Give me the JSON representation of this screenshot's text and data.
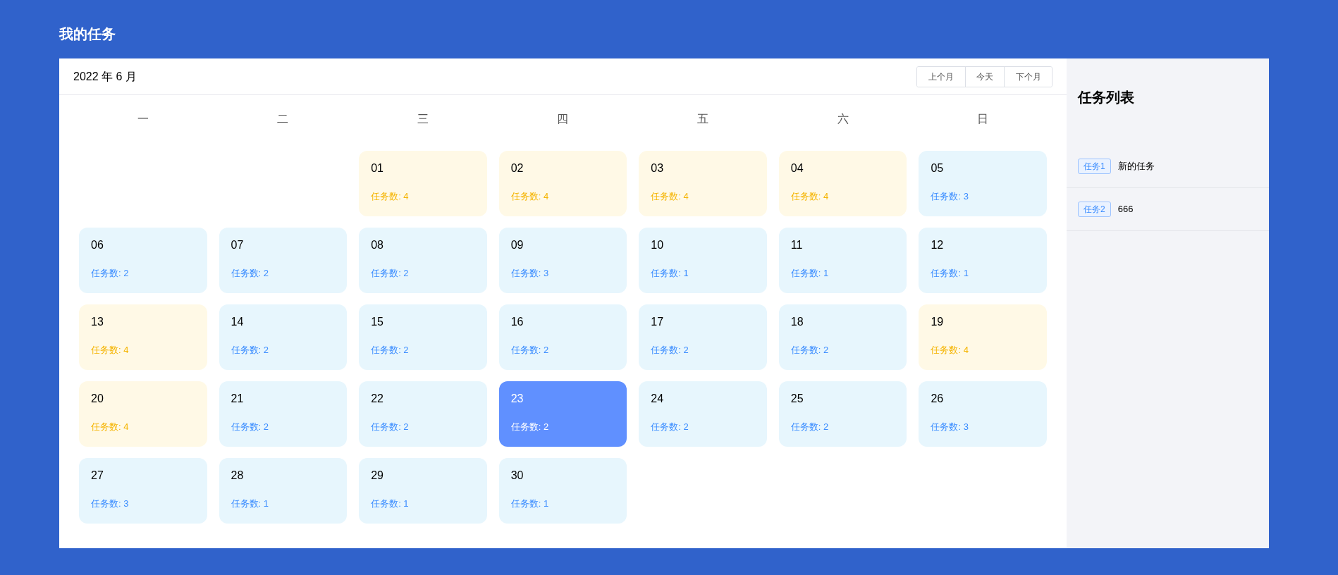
{
  "page_title": "我的任务",
  "calendar": {
    "month_label": "2022 年 6 月",
    "nav_buttons": [
      "上个月",
      "今天",
      "下个月"
    ],
    "weekdays": [
      "一",
      "二",
      "三",
      "四",
      "五",
      "六",
      "日"
    ],
    "weeks": [
      {
        "days": [
          {
            "kind": "blank"
          },
          {
            "kind": "blank"
          },
          {
            "kind": "busy",
            "date": "01",
            "count": "任务数: 4",
            "selected": false
          },
          {
            "kind": "busy",
            "date": "02",
            "count": "任务数: 4",
            "selected": false
          },
          {
            "kind": "busy",
            "date": "03",
            "count": "任务数: 4",
            "selected": false
          },
          {
            "kind": "busy",
            "date": "04",
            "count": "任务数: 4",
            "selected": false
          },
          {
            "kind": "normal",
            "date": "05",
            "count": "任务数: 3",
            "selected": false
          }
        ]
      },
      {
        "days": [
          {
            "kind": "normal",
            "date": "06",
            "count": "任务数: 2",
            "selected": false
          },
          {
            "kind": "normal",
            "date": "07",
            "count": "任务数: 2",
            "selected": false
          },
          {
            "kind": "normal",
            "date": "08",
            "count": "任务数: 2",
            "selected": false
          },
          {
            "kind": "normal",
            "date": "09",
            "count": "任务数: 3",
            "selected": false
          },
          {
            "kind": "normal",
            "date": "10",
            "count": "任务数: 1",
            "selected": false
          },
          {
            "kind": "normal",
            "date": "11",
            "count": "任务数: 1",
            "selected": false
          },
          {
            "kind": "normal",
            "date": "12",
            "count": "任务数: 1",
            "selected": false
          }
        ]
      },
      {
        "days": [
          {
            "kind": "busy",
            "date": "13",
            "count": "任务数: 4",
            "selected": false
          },
          {
            "kind": "normal",
            "date": "14",
            "count": "任务数: 2",
            "selected": false
          },
          {
            "kind": "normal",
            "date": "15",
            "count": "任务数: 2",
            "selected": false
          },
          {
            "kind": "normal",
            "date": "16",
            "count": "任务数: 2",
            "selected": false
          },
          {
            "kind": "normal",
            "date": "17",
            "count": "任务数: 2",
            "selected": false
          },
          {
            "kind": "normal",
            "date": "18",
            "count": "任务数: 2",
            "selected": false
          },
          {
            "kind": "busy",
            "date": "19",
            "count": "任务数: 4",
            "selected": false
          }
        ]
      },
      {
        "days": [
          {
            "kind": "busy",
            "date": "20",
            "count": "任务数: 4",
            "selected": false
          },
          {
            "kind": "normal",
            "date": "21",
            "count": "任务数: 2",
            "selected": false
          },
          {
            "kind": "normal",
            "date": "22",
            "count": "任务数: 2",
            "selected": false
          },
          {
            "kind": "normal",
            "date": "23",
            "count": "任务数: 2",
            "selected": true
          },
          {
            "kind": "normal",
            "date": "24",
            "count": "任务数: 2",
            "selected": false
          },
          {
            "kind": "normal",
            "date": "25",
            "count": "任务数: 2",
            "selected": false
          },
          {
            "kind": "normal",
            "date": "26",
            "count": "任务数: 3",
            "selected": false
          }
        ]
      },
      {
        "days": [
          {
            "kind": "normal",
            "date": "27",
            "count": "任务数: 3",
            "selected": false
          },
          {
            "kind": "normal",
            "date": "28",
            "count": "任务数: 1",
            "selected": false
          },
          {
            "kind": "normal",
            "date": "29",
            "count": "任务数: 1",
            "selected": false
          },
          {
            "kind": "normal",
            "date": "30",
            "count": "任务数: 1",
            "selected": false
          },
          {
            "kind": "blank"
          },
          {
            "kind": "blank"
          },
          {
            "kind": "blank"
          }
        ]
      }
    ]
  },
  "task_list": {
    "title": "任务列表",
    "items": [
      {
        "tag": "任务1",
        "name": "新的任务"
      },
      {
        "tag": "任务2",
        "name": "666"
      }
    ]
  }
}
